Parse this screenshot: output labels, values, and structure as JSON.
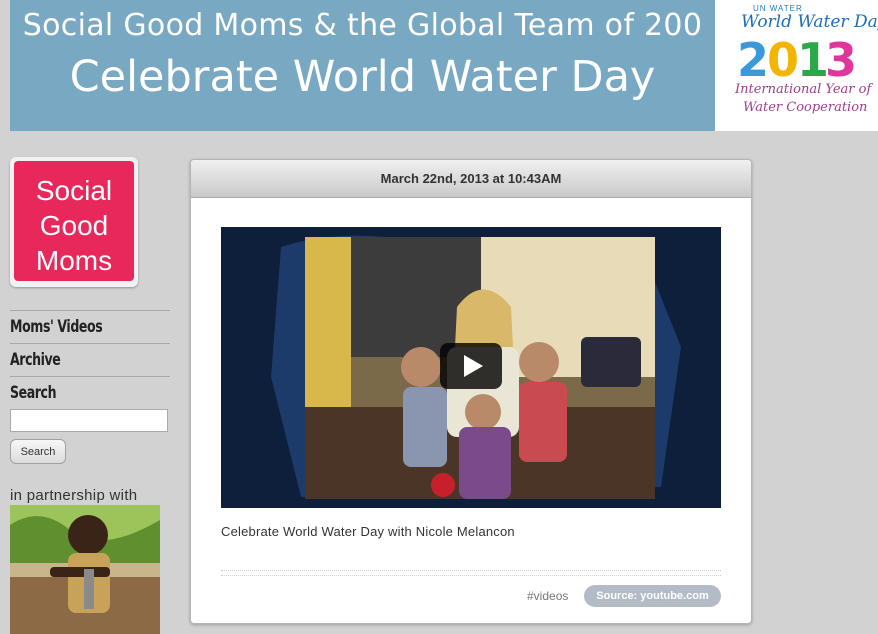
{
  "banner": {
    "subtitle": "Social Good Moms & the Global Team of 200",
    "title": "Celebrate World Water Day"
  },
  "wwd_logo": {
    "org": "UN WATER",
    "event": "World Water Day",
    "year": "2013",
    "line1": "International Year of",
    "line2": "Water Cooperation"
  },
  "sidebar": {
    "logo_text": [
      "Social",
      "Good",
      "Moms"
    ],
    "nav": [
      {
        "label": "Moms' Videos"
      },
      {
        "label": "Archive"
      },
      {
        "label": "Search"
      }
    ],
    "search_placeholder": "",
    "search_button": "Search",
    "partner_label": "in partnership with"
  },
  "post": {
    "date": "March 22nd, 2013 at 10:43AM",
    "caption": "Celebrate World Water Day with Nicole Melancon",
    "tag": "#videos",
    "source": "Source: youtube.com"
  },
  "colors": {
    "banner": "#78a8c2",
    "logo_pink": "#e8285b",
    "background": "#d2d2d2"
  }
}
